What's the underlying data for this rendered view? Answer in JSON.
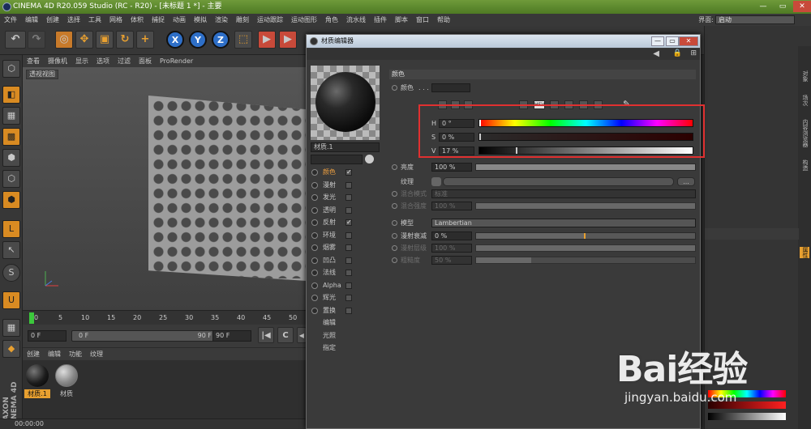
{
  "window": {
    "title": "CINEMA 4D R20.059 Studio (RC - R20) - [未标题 1 *] - 主要",
    "minimize": "—",
    "maximize": "▭",
    "close": "✕"
  },
  "menubar": {
    "items": [
      "文件",
      "编辑",
      "创建",
      "选择",
      "工具",
      "网格",
      "体积",
      "捕捉",
      "动画",
      "模拟",
      "渲染",
      "雕刻",
      "运动跟踪",
      "运动图形",
      "角色",
      "流水线",
      "插件",
      "脚本",
      "窗口",
      "帮助"
    ],
    "interface_label": "界面:",
    "interface_value": "启动"
  },
  "toolbar": {
    "x": "X",
    "y": "Y",
    "z": "Z"
  },
  "viewport": {
    "menu": [
      "查看",
      "摄像机",
      "显示",
      "选项",
      "过滤",
      "面板",
      "ProRender"
    ],
    "label": "透视视图"
  },
  "timeline": {
    "ticks": [
      "0",
      "5",
      "10",
      "15",
      "20",
      "25",
      "30",
      "35",
      "40",
      "45",
      "50",
      "55",
      "60",
      "65",
      "70",
      "75",
      "80",
      "85",
      "90"
    ],
    "start": "0 F",
    "current": "0 F",
    "end_range": "90 F",
    "end": "90 F"
  },
  "material_manager": {
    "menu": [
      "创建",
      "编辑",
      "功能",
      "纹理"
    ],
    "materials": [
      {
        "name": "材质.1",
        "selected": true
      },
      {
        "name": "材质",
        "selected": false
      }
    ]
  },
  "status": {
    "time": "00:00:00"
  },
  "brand": {
    "vertical": "MAXON CINEMA 4D"
  },
  "right_panel": {
    "tabs": [
      "对象",
      "场次",
      "内容浏览器",
      "构造"
    ],
    "attr_tab": "属性"
  },
  "material_editor": {
    "title": "材质编辑器",
    "material_name": "材质.1",
    "channels": [
      {
        "label": "颜色",
        "checked": true,
        "selected": true
      },
      {
        "label": "漫射",
        "checked": false
      },
      {
        "label": "发光",
        "checked": false
      },
      {
        "label": "透明",
        "checked": false
      },
      {
        "label": "反射",
        "checked": true
      },
      {
        "label": "环境",
        "checked": false
      },
      {
        "label": "烟雾",
        "checked": false
      },
      {
        "label": "凹凸",
        "checked": false
      },
      {
        "label": "法线",
        "checked": false
      },
      {
        "label": "Alpha",
        "checked": false
      },
      {
        "label": "辉光",
        "checked": false
      },
      {
        "label": "置换",
        "checked": false
      }
    ],
    "extras": [
      "编辑",
      "光照",
      "指定"
    ],
    "color_section": "颜色",
    "color_label": "颜色",
    "hsv_tab": "HSV",
    "hsv": {
      "h_label": "H",
      "h_value": "0 °",
      "h_fraction": 0.0,
      "s_label": "S",
      "s_value": "0 %",
      "s_fraction": 0.0,
      "v_label": "V",
      "v_value": "17 %",
      "v_fraction": 0.17
    },
    "brightness_label": "亮度",
    "brightness_value": "100 %",
    "texture_label": "纹理",
    "texture_btn": "...",
    "blend_mode_label": "混合模式",
    "blend_mode_value": "标准",
    "blend_strength_label": "混合强度",
    "blend_strength_value": "100 %",
    "model_label": "模型",
    "model_value": "Lambertian",
    "diffuse_falloff_label": "漫射衰减",
    "diffuse_falloff_value": "0 %",
    "diffuse_level_label": "漫射层级",
    "diffuse_level_value": "100 %",
    "roughness_label": "粗糙度",
    "roughness_value": "50 %"
  },
  "watermark": {
    "text": "Bai经验",
    "url": "jingyan.baidu.com"
  },
  "colors": {
    "accent": "#e03030",
    "selection": "#f0a040",
    "titlebar": "#5f8a30"
  }
}
